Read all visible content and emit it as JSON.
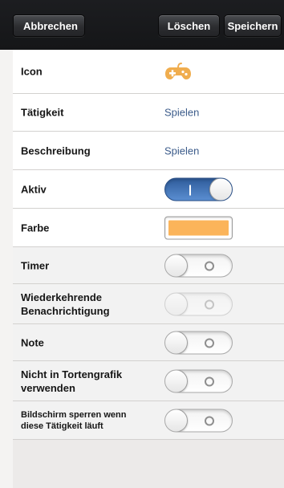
{
  "toolbar": {
    "cancel_label": "Abbrechen",
    "delete_label": "Löschen",
    "save_label": "Speichern"
  },
  "form": {
    "icon": {
      "label": "Icon",
      "icon_name": "gamepad-icon",
      "color": "#f0ad4e"
    },
    "activity": {
      "label": "Tätigkeit",
      "value": "Spielen"
    },
    "description": {
      "label": "Beschreibung",
      "value": "Spielen"
    },
    "active": {
      "label": "Aktiv",
      "state": "on"
    },
    "color": {
      "label": "Farbe",
      "value": "#fbb45a"
    },
    "timer": {
      "label": "Timer",
      "state": "off"
    },
    "recurring": {
      "label_line1": "Wiederkehrende",
      "label_line2": "Benachrichtigung",
      "state": "off-disabled"
    },
    "note": {
      "label": "Note",
      "state": "off"
    },
    "pie_chart": {
      "label_line1": "Nicht in Tortengrafik",
      "label_line2": "verwenden",
      "state": "off"
    },
    "lock_screen": {
      "label_line1": "Bildschirm sperren wenn",
      "label_line2": "diese Tätigkeit läuft",
      "state": "off"
    }
  },
  "colors": {
    "accent_blue": "#3b5b8a",
    "toggle_on": "#2f5c9b",
    "toolbar_bg": "#1c1d20"
  }
}
